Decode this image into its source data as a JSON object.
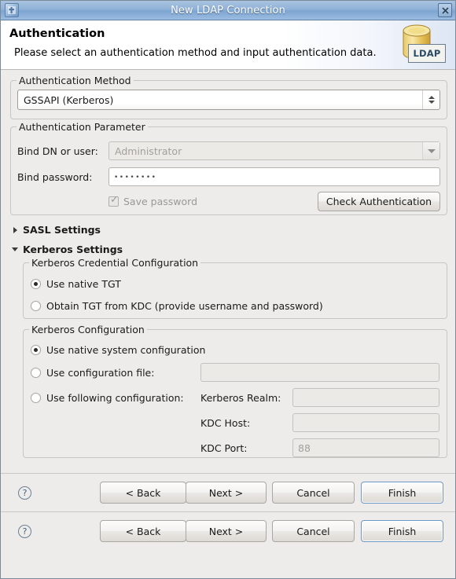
{
  "window": {
    "title": "New LDAP Connection",
    "app_icon": "ldap-window-icon",
    "close_label": "✕"
  },
  "header": {
    "title": "Authentication",
    "subtitle": "Please select an authentication method and input authentication data.",
    "logo_text": "LDAP"
  },
  "auth_method": {
    "legend": "Authentication Method",
    "selected": "GSSAPI (Kerberos)"
  },
  "auth_parameter": {
    "legend": "Authentication Parameter",
    "bind_dn_label": "Bind DN or user:",
    "bind_dn_value": "Administrator",
    "bind_password_label": "Bind password:",
    "bind_password_value": "••••••••",
    "save_password_label": "Save password",
    "save_password_checked": true,
    "check_auth_label": "Check Authentication"
  },
  "sections": {
    "sasl": {
      "label": "SASL Settings",
      "expanded": false
    },
    "kerberos": {
      "label": "Kerberos Settings",
      "expanded": true
    }
  },
  "credential_config": {
    "legend": "Kerberos Credential Configuration",
    "options": [
      {
        "label": "Use native TGT",
        "checked": true
      },
      {
        "label": "Obtain TGT from KDC (provide username and password)",
        "checked": false
      }
    ]
  },
  "kerberos_config": {
    "legend": "Kerberos Configuration",
    "options": [
      {
        "label": "Use native system configuration",
        "checked": true
      },
      {
        "label": "Use configuration file:",
        "checked": false
      },
      {
        "label": "Use following configuration:",
        "checked": false
      }
    ],
    "config_file_value": "",
    "fields": [
      {
        "label": "Kerberos Realm:",
        "value": ""
      },
      {
        "label": "KDC Host:",
        "value": ""
      },
      {
        "label": "KDC Port:",
        "value": "88"
      }
    ]
  },
  "buttonbar": {
    "help_icon": "?",
    "buttons": [
      {
        "label": "< Back",
        "mnemonic": "B",
        "primary": false
      },
      {
        "label": "Next >",
        "mnemonic": "N",
        "primary": false
      },
      {
        "label": "Cancel",
        "mnemonic": "",
        "primary": false
      },
      {
        "label": "Finish",
        "mnemonic": "F",
        "primary": true
      }
    ]
  },
  "colors": {
    "titlebar_blue": "#90b2d8",
    "dialog_bg": "#edecea",
    "focus_blue": "#6f97c4",
    "disabled_text": "#a2a09c"
  }
}
